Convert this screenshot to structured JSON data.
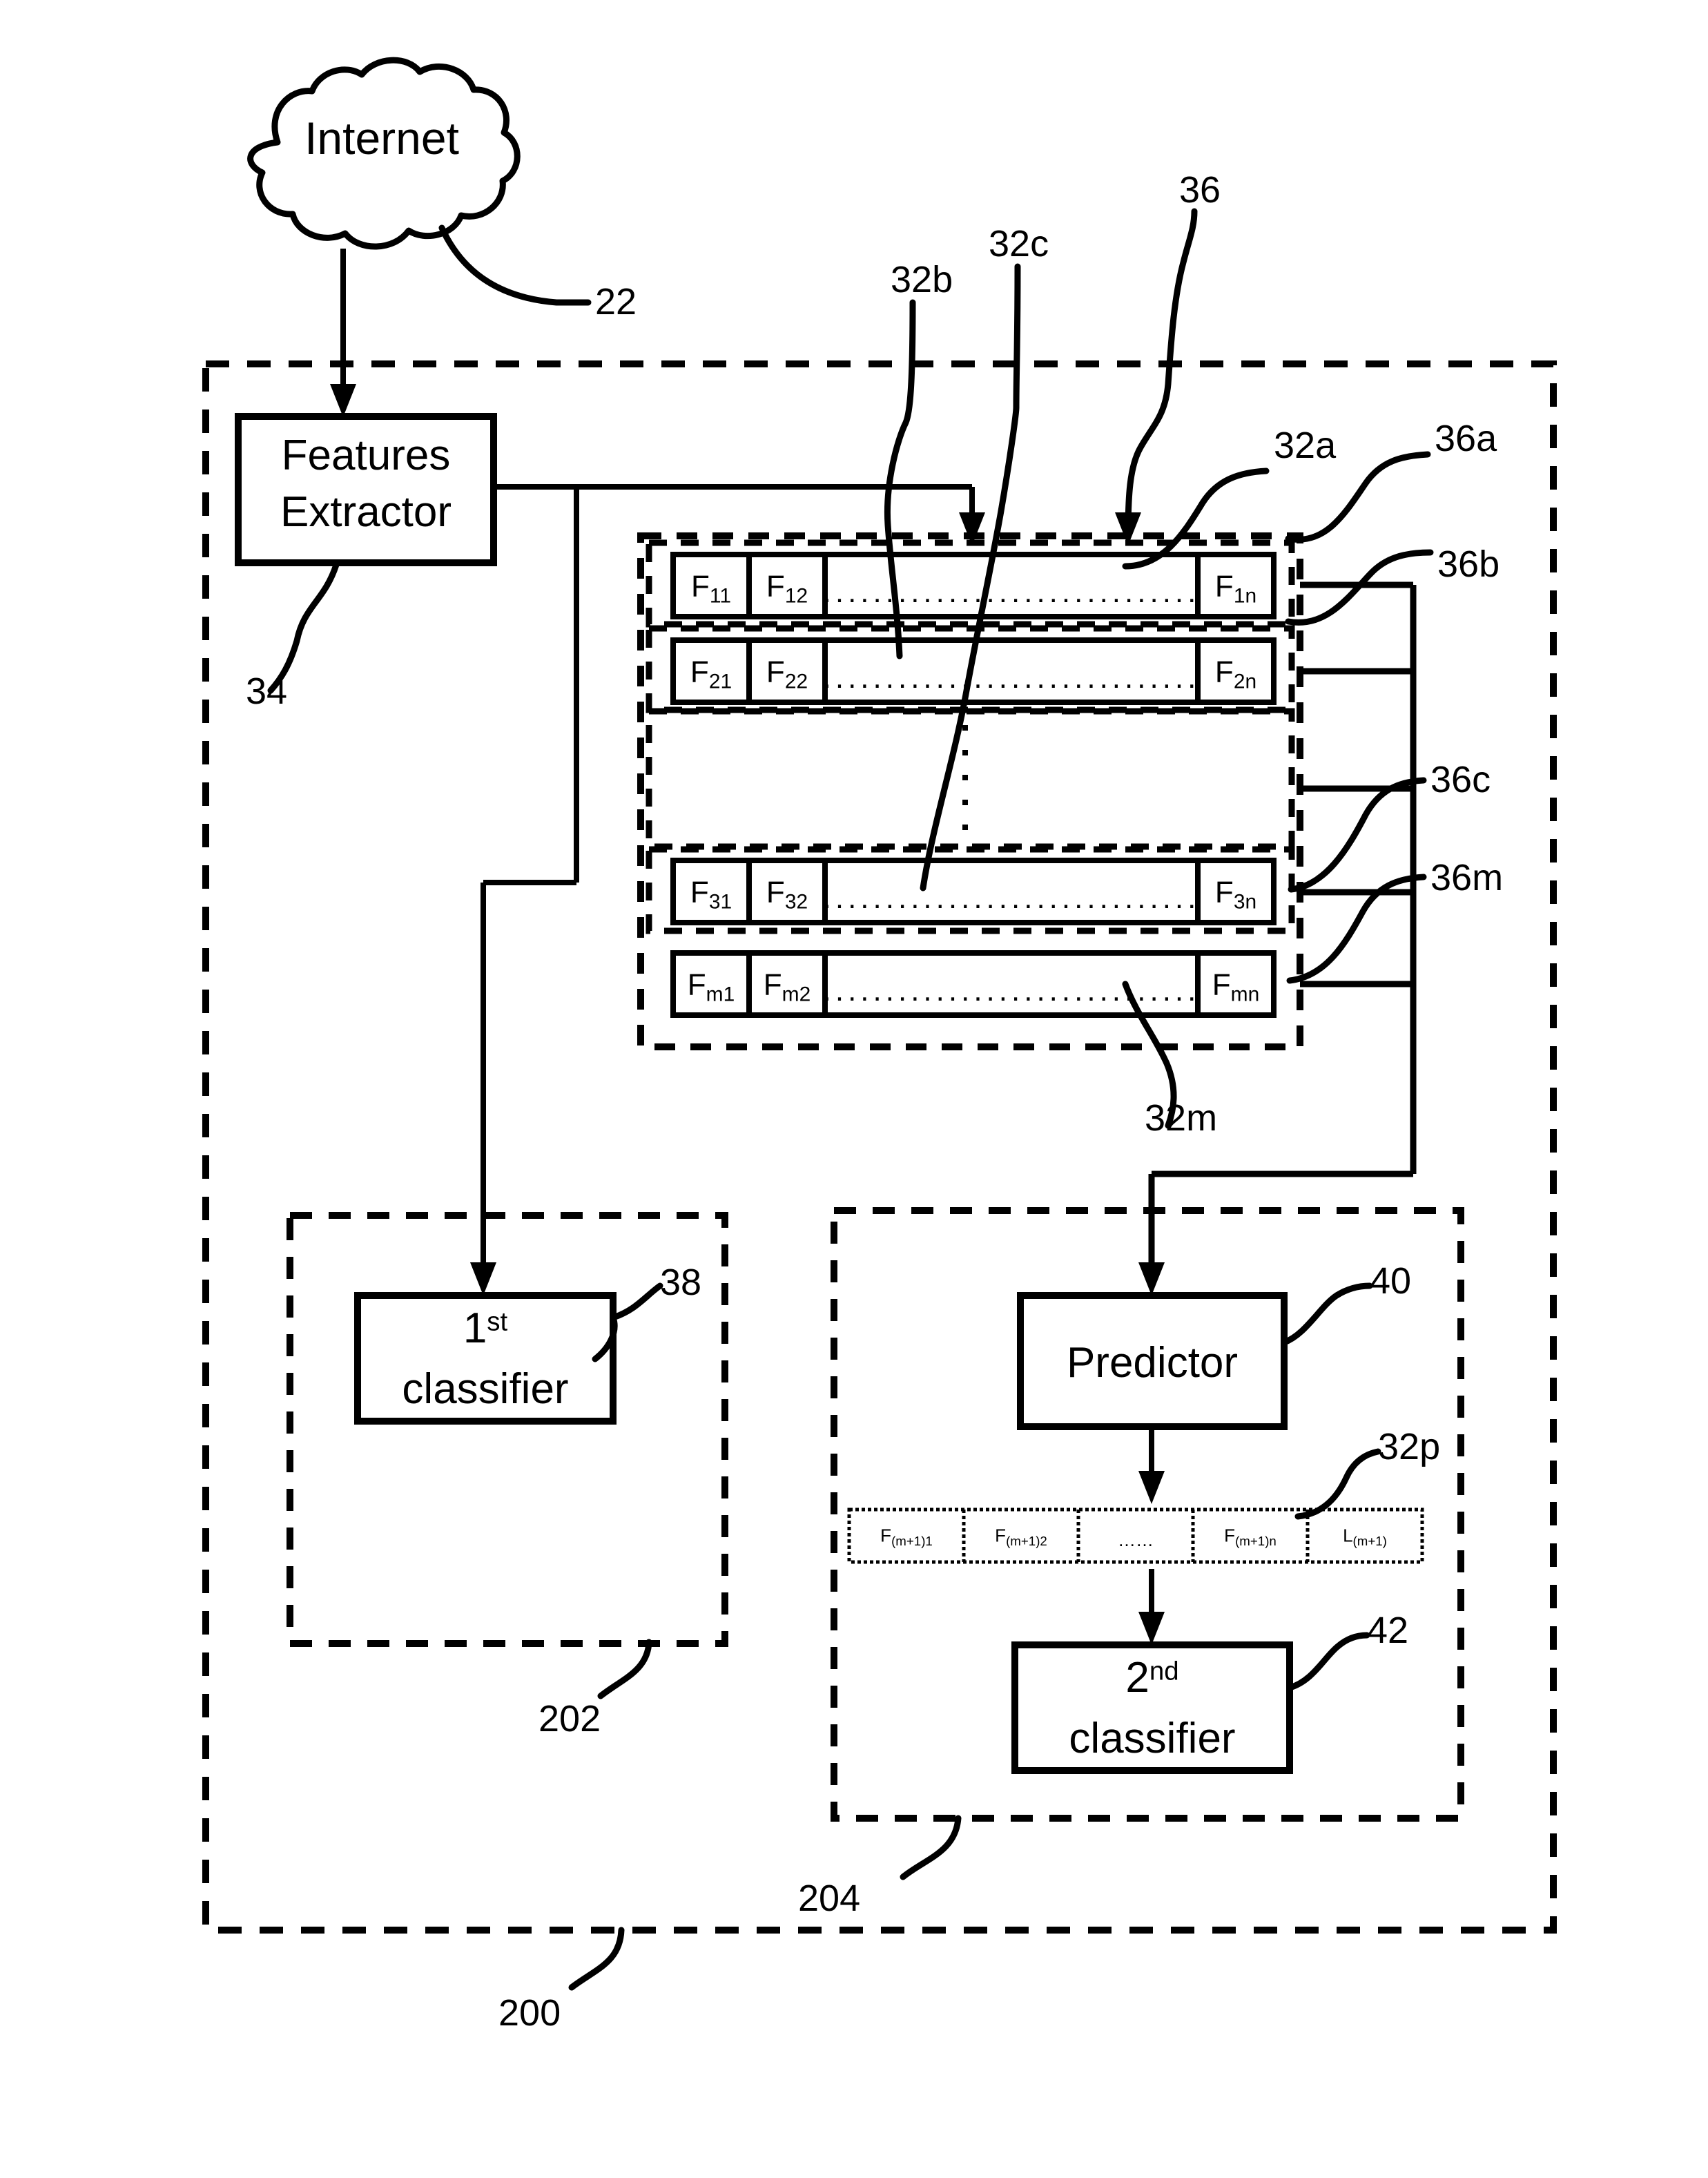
{
  "figure": {
    "title": "Two-stage feature classification block diagram",
    "source_network": {
      "label": "Internet",
      "ref": "22",
      "icon": "cloud-icon"
    },
    "system_ref": "200",
    "blocks": [
      {
        "id": "features-extractor",
        "label_line1": "Features",
        "label_line2": "Extractor",
        "ref": "34"
      },
      {
        "id": "first-classifier",
        "label_line1": "1",
        "label_sup": "st",
        "label_line2": "classifier",
        "ref": "38"
      },
      {
        "id": "predictor",
        "label_line1": "Predictor",
        "ref": "40"
      },
      {
        "id": "second-classifier",
        "label_line1": "2",
        "label_sup": "nd",
        "label_line2": "classifier",
        "ref": "42"
      }
    ],
    "containers": [
      {
        "id": "system-boundary",
        "ref": "200"
      },
      {
        "id": "first-stage-boundary",
        "ref": "202"
      },
      {
        "id": "second-stage-boundary",
        "ref": "204"
      },
      {
        "id": "feature-matrix",
        "ref": "36"
      }
    ],
    "matrix": {
      "container_ref": "36",
      "row_group_refs": [
        "32a",
        "32b",
        "32c",
        "32m"
      ],
      "output_refs": [
        "36a",
        "36b",
        "36c",
        "36m"
      ],
      "ellipsis_text": "..............................",
      "vertical_ellipsis": "⋮",
      "rows": [
        {
          "ref": "32a",
          "out_ref": "36a",
          "cells": [
            {
              "base": "F",
              "sub": "11"
            },
            {
              "base": "F",
              "sub": "12"
            },
            {
              "base": "",
              "sub": "",
              "dots": true
            },
            {
              "base": "F",
              "sub": "1n"
            }
          ]
        },
        {
          "ref": "32b",
          "out_ref": "36b",
          "cells": [
            {
              "base": "F",
              "sub": "21"
            },
            {
              "base": "F",
              "sub": "22"
            },
            {
              "base": "",
              "sub": "",
              "dots": true
            },
            {
              "base": "F",
              "sub": "2n"
            }
          ]
        },
        {
          "ref": "32c",
          "out_ref": "36c",
          "cells": [
            {
              "base": "F",
              "sub": "31"
            },
            {
              "base": "F",
              "sub": "32"
            },
            {
              "base": "",
              "sub": "",
              "dots": true
            },
            {
              "base": "F",
              "sub": "3n"
            }
          ]
        },
        {
          "ref": "32m",
          "out_ref": "36m",
          "cells": [
            {
              "base": "F",
              "sub": "m1"
            },
            {
              "base": "F",
              "sub": "m2"
            },
            {
              "base": "",
              "sub": "",
              "dots": true
            },
            {
              "base": "F",
              "sub": "mn"
            }
          ]
        }
      ]
    },
    "prediction_vector": {
      "ref": "32p",
      "cells": [
        {
          "base": "F",
          "sub": "(m+1)1"
        },
        {
          "base": "F",
          "sub": "(m+1)2"
        },
        {
          "base": "……",
          "sub": ""
        },
        {
          "base": "F",
          "sub": "(m+1)n"
        },
        {
          "base": "L",
          "sub": "(m+1)"
        }
      ]
    },
    "callouts": {
      "internet": "22",
      "features_extractor": "34",
      "matrix": "36",
      "row_a": "32a",
      "row_b": "32b",
      "row_c": "32c",
      "row_m": "32m",
      "out_a": "36a",
      "out_b": "36b",
      "out_c": "36c",
      "out_m": "36m",
      "first_classifier": "38",
      "predictor": "40",
      "pred_vector": "32p",
      "second_classifier": "42",
      "stage_one": "202",
      "stage_two": "204",
      "system": "200"
    },
    "colors": {
      "stroke": "#000000",
      "background": "#ffffff"
    }
  }
}
